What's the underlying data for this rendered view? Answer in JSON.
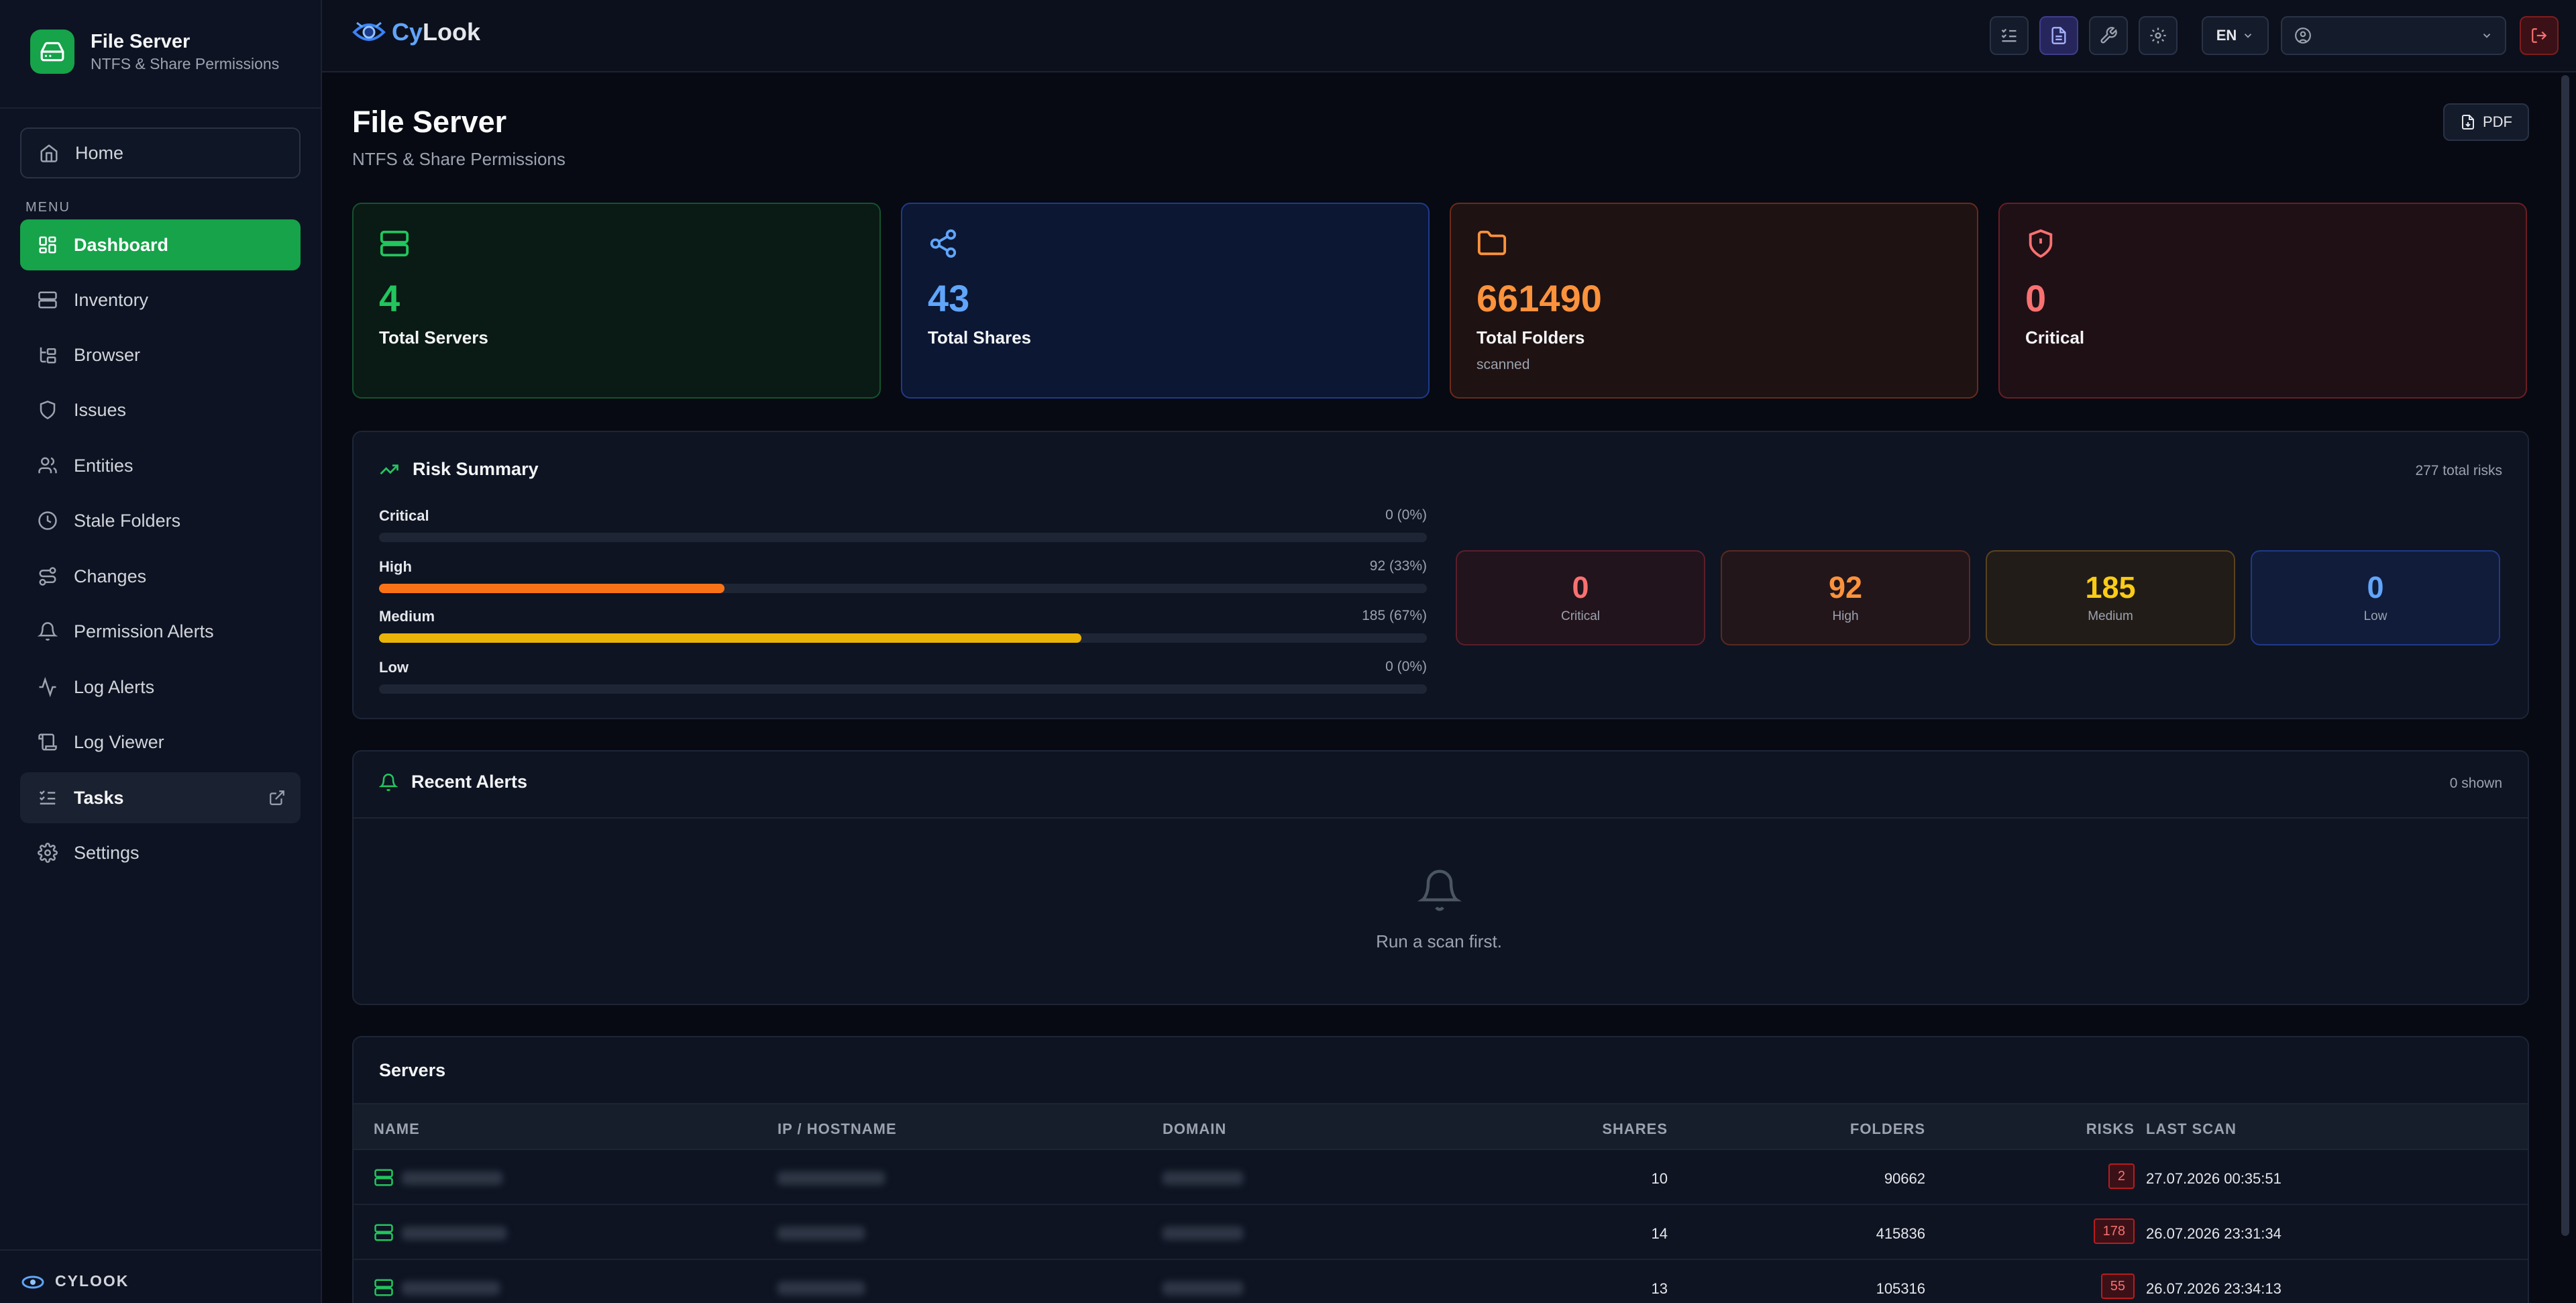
{
  "sidebar": {
    "app_title": "File Server",
    "app_subtitle": "NTFS & Share Permissions",
    "home_label": "Home",
    "menu_label": "MENU",
    "items": [
      {
        "label": "Dashboard",
        "icon": "grid-icon"
      },
      {
        "label": "Inventory",
        "icon": "server-icon"
      },
      {
        "label": "Browser",
        "icon": "folder-tree-icon"
      },
      {
        "label": "Issues",
        "icon": "shield-icon"
      },
      {
        "label": "Entities",
        "icon": "users-icon"
      },
      {
        "label": "Stale Folders",
        "icon": "clock-icon"
      },
      {
        "label": "Changes",
        "icon": "route-icon"
      },
      {
        "label": "Permission Alerts",
        "icon": "bell-icon"
      },
      {
        "label": "Log Alerts",
        "icon": "activity-icon"
      },
      {
        "label": "Log Viewer",
        "icon": "scroll-icon"
      },
      {
        "label": "Tasks",
        "icon": "checklist-icon"
      },
      {
        "label": "Settings",
        "icon": "gear-icon"
      }
    ],
    "footer_label": "CYLOOK"
  },
  "topbar": {
    "logo_cy": "Cy",
    "logo_look": "Look",
    "language": "EN"
  },
  "header": {
    "title": "File Server",
    "subtitle": "NTFS & Share Permissions",
    "pdf_label": "PDF"
  },
  "stats": [
    {
      "value": "4",
      "label": "Total Servers",
      "sub": "",
      "color": "#22c55e"
    },
    {
      "value": "43",
      "label": "Total Shares",
      "sub": "",
      "color": "#60a5fa"
    },
    {
      "value": "661490",
      "label": "Total Folders",
      "sub": "scanned",
      "color": "#fb923c"
    },
    {
      "value": "0",
      "label": "Critical",
      "sub": "",
      "color": "#f87171"
    }
  ],
  "risk_summary": {
    "title": "Risk Summary",
    "total": "277 total risks",
    "rows": [
      {
        "name": "Critical",
        "value": "0 (0%)",
        "percent": 0,
        "color": "#ef4444"
      },
      {
        "name": "High",
        "value": "92 (33%)",
        "percent": 33,
        "color": "#f97316"
      },
      {
        "name": "Medium",
        "value": "185 (67%)",
        "percent": 67,
        "color": "#eab308"
      },
      {
        "name": "Low",
        "value": "0 (0%)",
        "percent": 0,
        "color": "#3b82f6"
      }
    ],
    "boxes": [
      {
        "value": "0",
        "label": "Critical",
        "color": "#f87171"
      },
      {
        "value": "92",
        "label": "High",
        "color": "#fb923c"
      },
      {
        "value": "185",
        "label": "Medium",
        "color": "#facc15"
      },
      {
        "value": "0",
        "label": "Low",
        "color": "#60a5fa"
      }
    ]
  },
  "recent_alerts": {
    "title": "Recent Alerts",
    "count": "0 shown",
    "empty_text": "Run a scan first."
  },
  "servers": {
    "title": "Servers",
    "columns": [
      "NAME",
      "IP / HOSTNAME",
      "DOMAIN",
      "SHARES",
      "FOLDERS",
      "RISKS",
      "LAST SCAN"
    ],
    "rows": [
      {
        "shares": "10",
        "folders": "90662",
        "risks": "2",
        "last_scan": "27.07.2026 00:35:51"
      },
      {
        "shares": "14",
        "folders": "415836",
        "risks": "178",
        "last_scan": "26.07.2026 23:31:34"
      },
      {
        "shares": "13",
        "folders": "105316",
        "risks": "55",
        "last_scan": "26.07.2026 23:34:13"
      }
    ]
  }
}
